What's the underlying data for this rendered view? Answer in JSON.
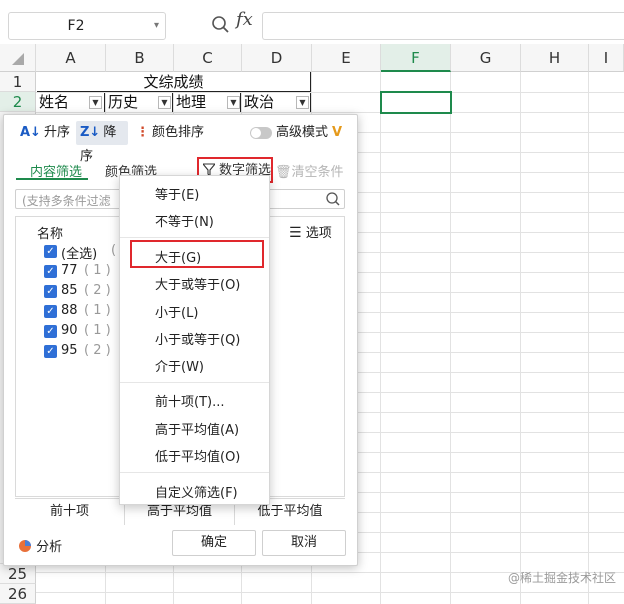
{
  "formula_bar": {
    "cell_ref": "F2",
    "fx": "fx",
    "value": ""
  },
  "columns": [
    "A",
    "B",
    "C",
    "D",
    "E",
    "F",
    "G",
    "H",
    "I"
  ],
  "active_column": "F",
  "rows": [
    "1",
    "2",
    "25",
    "26"
  ],
  "sheet": {
    "title": "文综成绩",
    "headers": [
      "姓名",
      "历史",
      "地理",
      "政治"
    ]
  },
  "panel": {
    "sort_asc": "升序",
    "sort_desc": "降序",
    "color_sort": "颜色排序",
    "advanced_mode": "高级模式",
    "advanced_badge": "V",
    "tab_content": "内容筛选",
    "tab_color": "颜色筛选",
    "tab_number": "数字筛选",
    "clear": "清空条件",
    "search_placeholder": "(支持多条件过滤",
    "list_header": "名称",
    "options": "选项",
    "items": [
      {
        "label": "(全选)",
        "count": "("
      },
      {
        "label": "77",
        "count": "( 1 )"
      },
      {
        "label": "85",
        "count": "( 2 )"
      },
      {
        "label": "88",
        "count": "( 1 )"
      },
      {
        "label": "90",
        "count": "( 1 )"
      },
      {
        "label": "95",
        "count": "( 2 )"
      }
    ],
    "quick": [
      "前十项",
      "高于平均值",
      "低于平均值"
    ],
    "analysis": "分析",
    "ok": "确定",
    "cancel": "取消"
  },
  "menu": {
    "items": [
      "等于(E)",
      "不等于(N)",
      "大于(G)",
      "大于或等于(O)",
      "小于(L)",
      "小于或等于(Q)",
      "介于(W)",
      "前十项(T)...",
      "高于平均值(A)",
      "低于平均值(O)",
      "自定义筛选(F)"
    ],
    "highlighted": "大于(G)"
  },
  "watermark": "@稀土掘金技术社区",
  "colors": {
    "accent_green": "#1e8a4c",
    "highlight_red": "#e0282d",
    "checkbox_blue": "#2f6fd6"
  }
}
